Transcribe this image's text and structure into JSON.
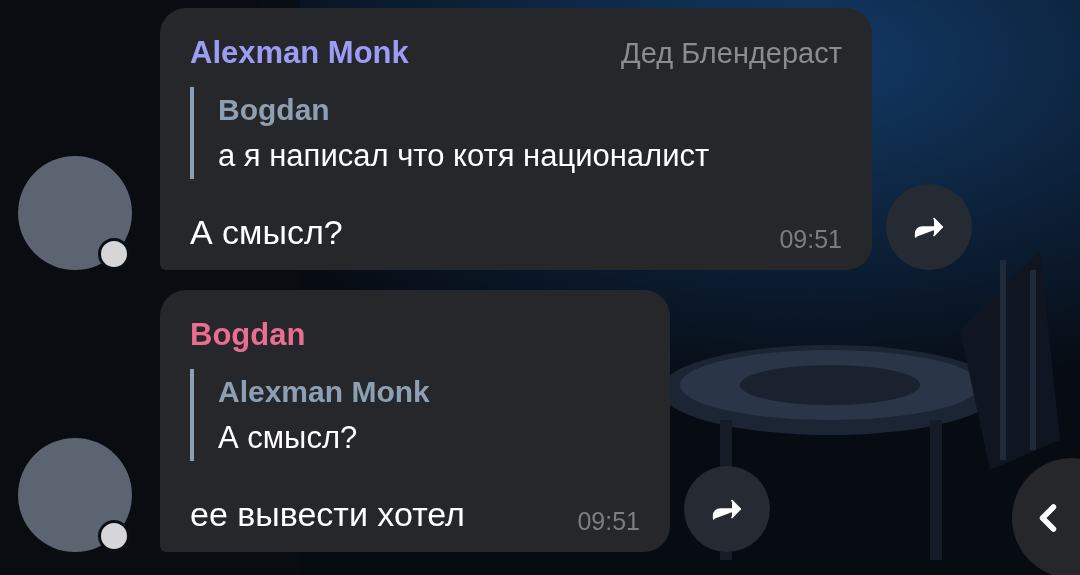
{
  "messages": [
    {
      "author": "Alexman Monk",
      "color": "#9c9cf5",
      "title": "Дед Блендераст",
      "reply": {
        "author": "Bogdan",
        "text": "а я написал что котя националист"
      },
      "text": "А смысл?",
      "time": "09:51"
    },
    {
      "author": "Bogdan",
      "color": "#ea6d92",
      "reply": {
        "author": "Alexman Monk",
        "text": "А смысл?"
      },
      "text": "ее вывести хотел",
      "time": "09:51"
    }
  ]
}
